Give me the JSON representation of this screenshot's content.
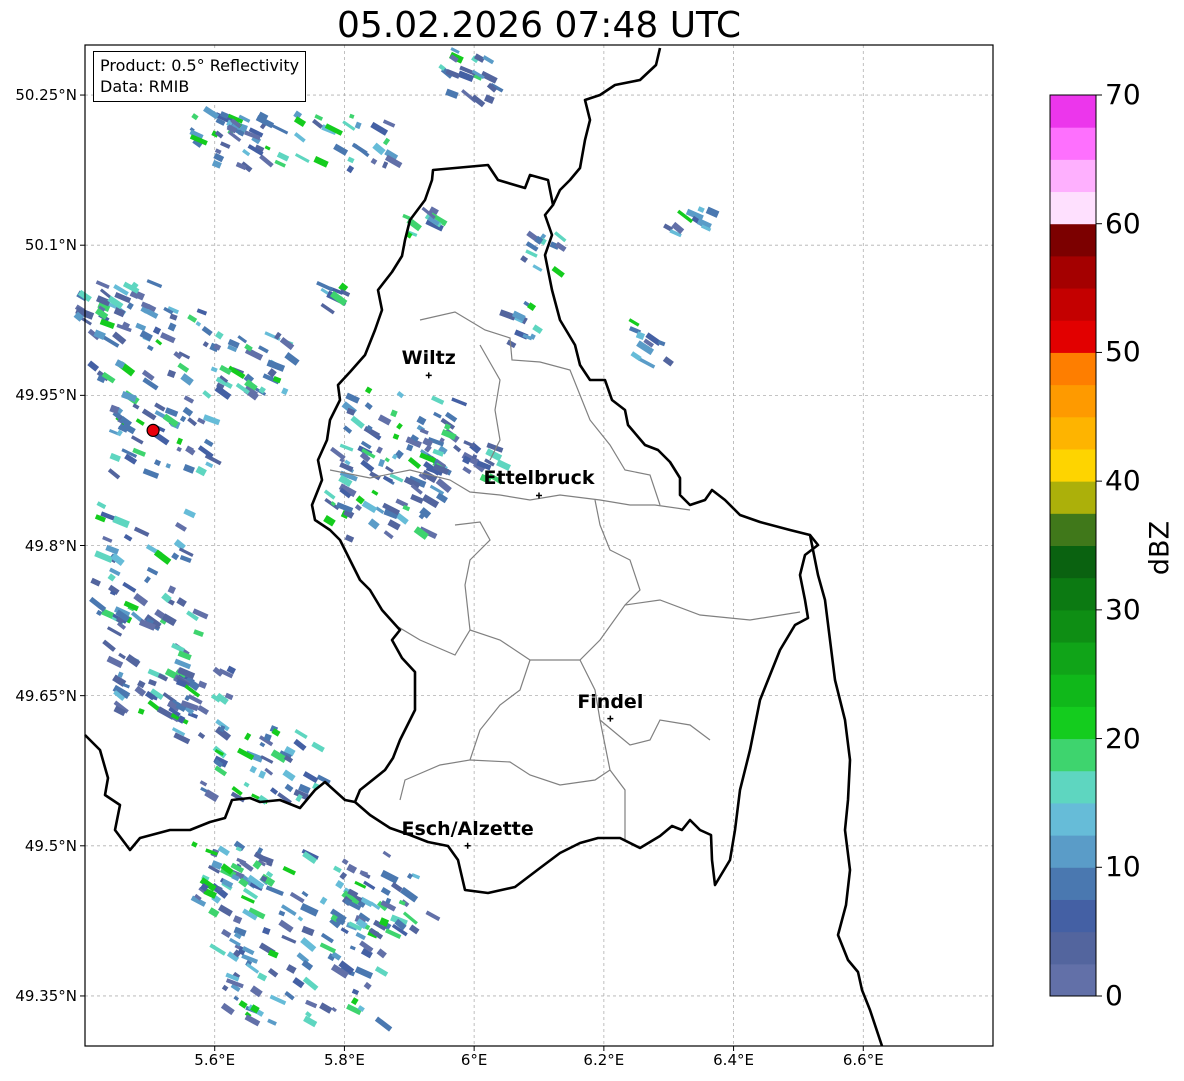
{
  "title": "05.02.2026 07:48 UTC",
  "info": {
    "product": "Product: 0.5° Reflectivity",
    "data": "Data: RMIB"
  },
  "lat_ticks": [
    {
      "value": 50.25,
      "label": "50.25°N"
    },
    {
      "value": 50.1,
      "label": "50.1°N"
    },
    {
      "value": 49.95,
      "label": "49.95°N"
    },
    {
      "value": 49.8,
      "label": "49.8°N"
    },
    {
      "value": 49.65,
      "label": "49.65°N"
    },
    {
      "value": 49.5,
      "label": "49.5°N"
    },
    {
      "value": 49.35,
      "label": "49.35°N"
    }
  ],
  "lon_ticks": [
    {
      "value": 5.6,
      "label": "5.6°E"
    },
    {
      "value": 5.8,
      "label": "5.8°E"
    },
    {
      "value": 6.0,
      "label": "6°E"
    },
    {
      "value": 6.2,
      "label": "6.2°E"
    },
    {
      "value": 6.4,
      "label": "6.4°E"
    },
    {
      "value": 6.6,
      "label": "6.6°E"
    }
  ],
  "extent": {
    "lon": [
      5.4,
      6.8
    ],
    "lat": [
      49.3,
      50.3
    ]
  },
  "cities": [
    {
      "name": "Wiltz",
      "lon": 5.93,
      "lat": 49.97
    },
    {
      "name": "Ettelbruck",
      "lon": 6.1,
      "lat": 49.85
    },
    {
      "name": "Findel",
      "lon": 6.21,
      "lat": 49.627
    },
    {
      "name": "Esch/Alzette",
      "lon": 5.99,
      "lat": 49.5
    }
  ],
  "radar_site": {
    "lon": 5.505,
    "lat": 49.915,
    "color": "#e8000b"
  },
  "colorbar": {
    "label": "dBZ",
    "min": 0,
    "max": 70,
    "ticks": [
      0,
      10,
      20,
      30,
      40,
      50,
      60,
      70
    ],
    "colors": [
      "#6270a8",
      "#53659e",
      "#4460a4",
      "#4a78b0",
      "#5a9cc8",
      "#66bcd8",
      "#5ed6c0",
      "#3ed46e",
      "#14cc1e",
      "#10b81a",
      "#10a418",
      "#0e8e14",
      "#0c7a12",
      "#0a6210",
      "#40781a",
      "#acb00a",
      "#fed400",
      "#feb400",
      "#fe9a00",
      "#fe7e00",
      "#e20000",
      "#c40000",
      "#a40000",
      "#7c0000",
      "#fee0fe",
      "#feb0fe",
      "#fe70fe",
      "#ec36ec"
    ]
  }
}
